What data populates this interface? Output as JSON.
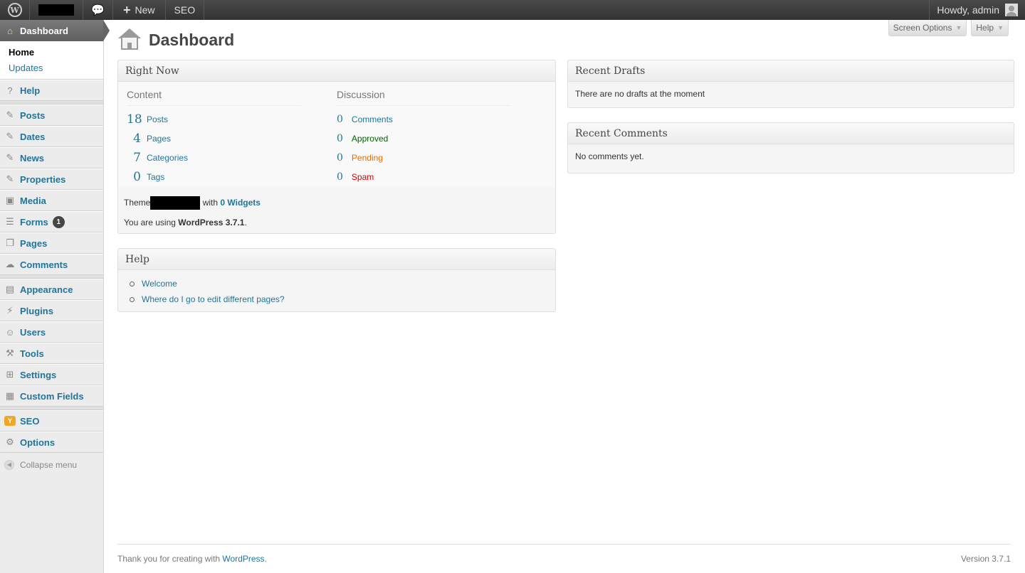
{
  "adminbar": {
    "wp_logo": "wordpress-logo-icon",
    "comments_icon": "speech-bubble-icon",
    "new_plus": "+",
    "new_label": "New",
    "seo_label": "SEO",
    "greeting": "Howdy, admin"
  },
  "sidebar": {
    "dashboard": "Dashboard",
    "dashboard_icon": "⌂",
    "submenu": {
      "home": "Home",
      "updates": "Updates"
    },
    "items": [
      {
        "label": "Help",
        "icon": "?"
      },
      {
        "label": "Posts",
        "icon": "✎"
      },
      {
        "label": "Dates",
        "icon": "✎"
      },
      {
        "label": "News",
        "icon": "✎"
      },
      {
        "label": "Properties",
        "icon": "✎"
      },
      {
        "label": "Media",
        "icon": "▣"
      },
      {
        "label": "Forms",
        "icon": "☰",
        "badge": "1"
      },
      {
        "label": "Pages",
        "icon": "❐"
      },
      {
        "label": "Comments",
        "icon": "☁"
      },
      {
        "label": "Appearance",
        "icon": "▤"
      },
      {
        "label": "Plugins",
        "icon": "⚡"
      },
      {
        "label": "Users",
        "icon": "☺"
      },
      {
        "label": "Tools",
        "icon": "⚒"
      },
      {
        "label": "Settings",
        "icon": "⊞"
      },
      {
        "label": "Custom Fields",
        "icon": "▦"
      },
      {
        "label": "SEO",
        "icon": "Y"
      },
      {
        "label": "Options",
        "icon": "⚙"
      }
    ],
    "collapse": "Collapse menu",
    "collapse_icon": "◀"
  },
  "header": {
    "title": "Dashboard",
    "screen_options": "Screen Options",
    "help": "Help",
    "dropdown_arrow": "▼"
  },
  "right_now": {
    "title": "Right Now",
    "content_head": "Content",
    "discussion_head": "Discussion",
    "content": [
      {
        "num": "18",
        "label": "Posts"
      },
      {
        "num": "4",
        "label": "Pages"
      },
      {
        "num": "7",
        "label": "Categories"
      },
      {
        "num": "0",
        "label": "Tags"
      }
    ],
    "discussion": [
      {
        "num": "0",
        "label": "Comments"
      },
      {
        "num": "0",
        "label": "Approved"
      },
      {
        "num": "0",
        "label": "Pending"
      },
      {
        "num": "0",
        "label": "Spam"
      }
    ],
    "theme_prefix": "Theme",
    "theme_with": "with",
    "widgets": "0 Widgets",
    "using_prefix": "You are using",
    "wp_version": "WordPress 3.7.1",
    "using_suffix": "."
  },
  "help_box": {
    "title": "Help",
    "links": [
      "Welcome",
      "Where do I go to edit different pages?"
    ]
  },
  "recent_drafts": {
    "title": "Recent Drafts",
    "text": "There are no drafts at the moment"
  },
  "recent_comments": {
    "title": "Recent Comments",
    "text": "No comments yet."
  },
  "footer": {
    "thanks_prefix": "Thank you for creating with",
    "wordpress": "WordPress",
    "thanks_suffix": ".",
    "version": "Version 3.7.1"
  }
}
